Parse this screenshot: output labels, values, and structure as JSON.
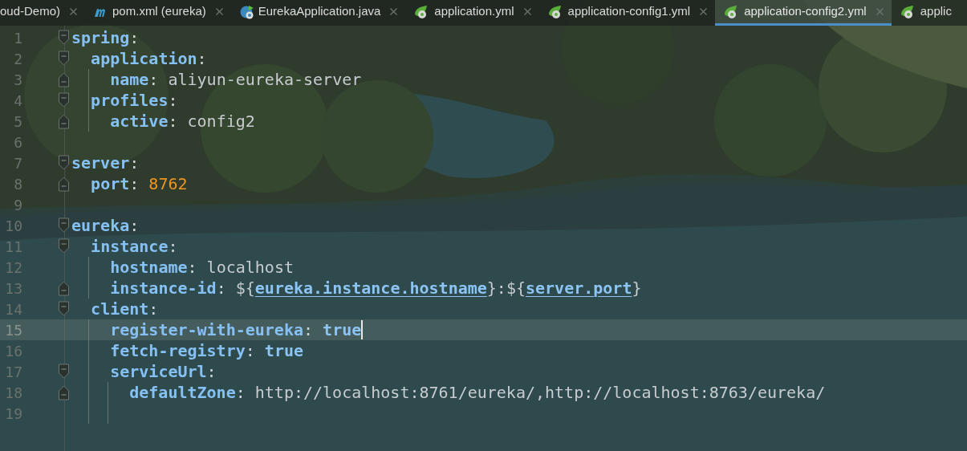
{
  "tabs": [
    {
      "label": "oud-Demo)",
      "kind": "plain",
      "selected": false
    },
    {
      "label": "pom.xml (eureka)",
      "kind": "maven",
      "selected": false
    },
    {
      "label": "EurekaApplication.java",
      "kind": "spring-class",
      "selected": false
    },
    {
      "label": "application.yml",
      "kind": "spring",
      "selected": false
    },
    {
      "label": "application-config1.yml",
      "kind": "spring",
      "selected": false
    },
    {
      "label": "application-config2.yml",
      "kind": "spring",
      "selected": true
    },
    {
      "label": "applic",
      "kind": "spring",
      "selected": false
    }
  ],
  "editor": {
    "lines": [
      {
        "number": "1",
        "kind": "fold-start",
        "current": false,
        "text": "spring:"
      },
      {
        "number": "2",
        "kind": "fold-start",
        "current": false,
        "text": "  application:"
      },
      {
        "number": "3",
        "kind": "fold-end",
        "current": false,
        "text": "    name: aliyun-eureka-server"
      },
      {
        "number": "4",
        "kind": "fold-start",
        "current": false,
        "text": "  profiles:"
      },
      {
        "number": "5",
        "kind": "fold-end",
        "current": false,
        "text": "    active: config2"
      },
      {
        "number": "6",
        "kind": "plain",
        "current": false
      },
      {
        "number": "7",
        "kind": "fold-start",
        "current": false,
        "text": "server:"
      },
      {
        "number": "8",
        "kind": "fold-end",
        "current": false,
        "text": "  port: 8762"
      },
      {
        "number": "9",
        "kind": "plain",
        "current": false
      },
      {
        "number": "10",
        "kind": "fold-start",
        "current": false,
        "text": "eureka:"
      },
      {
        "number": "11",
        "kind": "fold-start",
        "current": false,
        "text": "  instance:"
      },
      {
        "number": "12",
        "kind": "plain",
        "current": false,
        "text": "    hostname: localhost"
      },
      {
        "number": "13",
        "kind": "fold-end",
        "current": false,
        "text": "    instance-id: ${eureka.instance.hostname}:${server.port}"
      },
      {
        "number": "14",
        "kind": "fold-start",
        "current": false,
        "text": "  client:"
      },
      {
        "number": "15",
        "kind": "plain",
        "current": true,
        "text": "    register-with-eureka: true"
      },
      {
        "number": "16",
        "kind": "plain",
        "current": false,
        "text": "    fetch-registry: true"
      },
      {
        "number": "17",
        "kind": "fold-start",
        "current": false,
        "text": "    serviceUrl:"
      },
      {
        "number": "18",
        "kind": "fold-end",
        "current": false,
        "text": "      defaultZone: http://localhost:8761/eureka/,http://localhost:8763/eureka/"
      },
      {
        "number": "19",
        "kind": "plain",
        "current": false
      }
    ]
  }
}
